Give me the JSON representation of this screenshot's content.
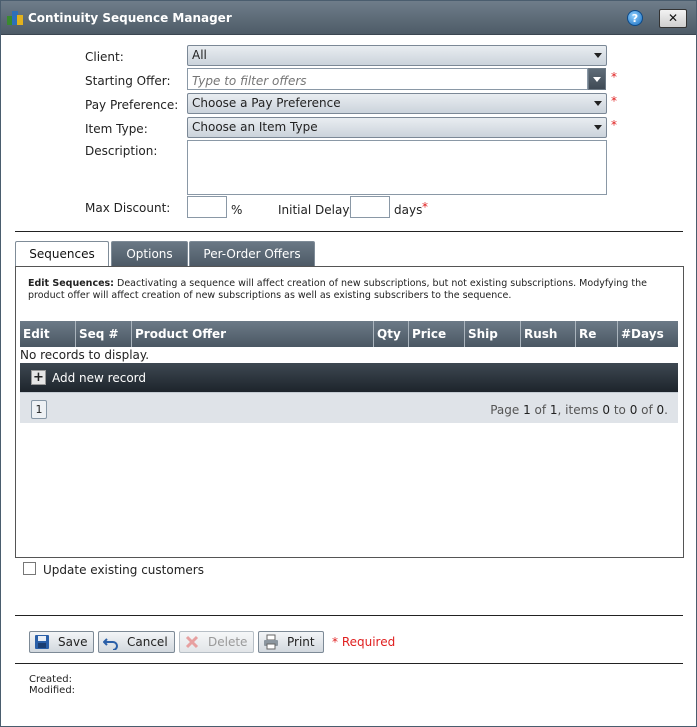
{
  "window": {
    "title": "Continuity Sequence Manager",
    "help_glyph": "?",
    "close_glyph": "✕"
  },
  "form": {
    "client_label": "Client:",
    "client_value": "All",
    "starting_offer_label": "Starting Offer:",
    "starting_offer_placeholder": "Type to filter offers",
    "pay_preference_label": "Pay Preference:",
    "pay_preference_value": "Choose a Pay Preference",
    "item_type_label": "Item Type:",
    "item_type_value": "Choose an Item Type",
    "description_label": "Description:",
    "description_value": "",
    "max_discount_label": "Max Discount:",
    "max_discount_value": "",
    "max_discount_unit": "%",
    "initial_delay_label": "Initial Delay:",
    "initial_delay_value": "",
    "initial_delay_unit": "days",
    "required_marker": "*"
  },
  "tabs": [
    {
      "label": "Sequences",
      "active": true
    },
    {
      "label": "Options",
      "active": false
    },
    {
      "label": "Per-Order Offers",
      "active": false
    }
  ],
  "sequences": {
    "note_title": "Edit Sequences:",
    "note_text": " Deactivating a sequence will affect creation of new subscriptions, but not existing subscriptions. Modyfying the product offer will affect creation of new subscriptions as well as existing subscribers to the sequence.",
    "columns": [
      "Edit",
      "Seq #",
      "Product Offer",
      "Qty",
      "Price",
      "Ship",
      "Rush",
      "Re",
      "#Days"
    ],
    "empty_text": "No records to display.",
    "add_label": "Add new record",
    "add_glyph": "+",
    "pager": {
      "page_button": "1",
      "t1": "Page ",
      "page": "1",
      "t2": " of ",
      "pages": "1",
      "t3": ", items ",
      "from": "0",
      "t4": " to ",
      "to": "0",
      "t5": " of ",
      "total": "0",
      "t6": "."
    }
  },
  "update_existing_label": "Update existing customers",
  "buttons": {
    "save": "Save",
    "cancel": "Cancel",
    "delete": "Delete",
    "print": "Print",
    "required_note": "* Required"
  },
  "meta": {
    "created_label": "Created:",
    "modified_label": "Modified:"
  },
  "colors": {
    "titlebar": "#55626e",
    "required": "#e02020",
    "grid_header": "#5b6874",
    "add_bar": "#2a323a"
  }
}
